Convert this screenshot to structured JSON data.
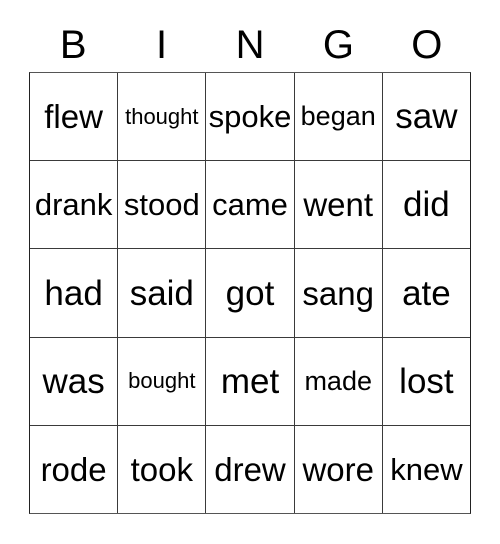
{
  "card": {
    "type": "bingo-card",
    "columns": 5,
    "rows": 5,
    "header": {
      "letters": [
        {
          "label": "B"
        },
        {
          "label": "I"
        },
        {
          "label": "N"
        },
        {
          "label": "G"
        },
        {
          "label": "O"
        }
      ]
    },
    "colors": {
      "background": "#ffffff",
      "text": "#000000",
      "grid_line": "#3a3a3a"
    },
    "grid": [
      [
        {
          "text": "flew",
          "size": "lg"
        },
        {
          "text": "thought",
          "size": "xs"
        },
        {
          "text": "spoke",
          "size": "md"
        },
        {
          "text": "began",
          "size": "sm"
        },
        {
          "text": "saw",
          "size": "xl"
        }
      ],
      [
        {
          "text": "drank",
          "size": "md"
        },
        {
          "text": "stood",
          "size": "md"
        },
        {
          "text": "came",
          "size": "md"
        },
        {
          "text": "went",
          "size": "lg"
        },
        {
          "text": "did",
          "size": "xl"
        }
      ],
      [
        {
          "text": "had",
          "size": "xl"
        },
        {
          "text": "said",
          "size": "xl"
        },
        {
          "text": "got",
          "size": "xl"
        },
        {
          "text": "sang",
          "size": "lg"
        },
        {
          "text": "ate",
          "size": "xl"
        }
      ],
      [
        {
          "text": "was",
          "size": "xl"
        },
        {
          "text": "bought",
          "size": "xs"
        },
        {
          "text": "met",
          "size": "xl"
        },
        {
          "text": "made",
          "size": "sm"
        },
        {
          "text": "lost",
          "size": "xl"
        }
      ],
      [
        {
          "text": "rode",
          "size": "lg"
        },
        {
          "text": "took",
          "size": "lg"
        },
        {
          "text": "drew",
          "size": "lg"
        },
        {
          "text": "wore",
          "size": "lg"
        },
        {
          "text": "knew",
          "size": "md"
        }
      ]
    ]
  }
}
